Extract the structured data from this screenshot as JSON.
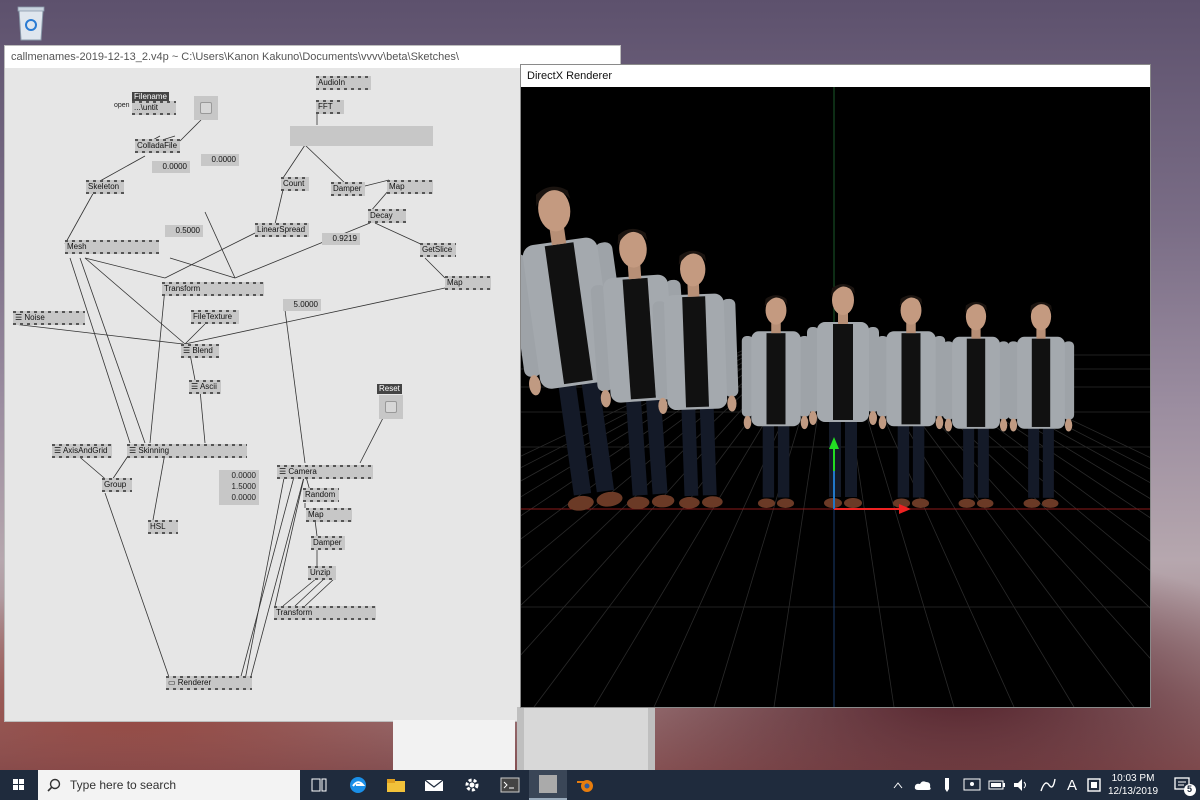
{
  "patch": {
    "title": "callmenames-2019-12-13_2.v4p ~   C:\\Users\\Kanon Kakuno\\Documents\\vvvv\\beta\\Sketches\\",
    "nodes": {
      "filename_label": "Filename",
      "open_label": "open",
      "filename_value": "...\\untit",
      "colladafile": "ColladaFile",
      "audioin": "AudioIn",
      "fft": "FFT",
      "count": "Count",
      "damper1": "Damper",
      "map1": "Map",
      "skeleton": "Skeleton",
      "decay": "Decay",
      "linearspread": "LinearSpread",
      "mesh": "Mesh",
      "getslice": "GetSlice",
      "transform1": "Transform",
      "map2": "Map",
      "noise": "Noise",
      "filetexture": "FileTexture",
      "blend": "Blend",
      "ascii": "Ascii",
      "reset_label": "Reset",
      "axisandgrid": "AxisAndGrid",
      "skinning": "Skinning",
      "camera": "Camera",
      "group": "Group",
      "random": "Random",
      "hsl": "HSL",
      "map3": "Map",
      "damper2": "Damper",
      "unzip": "Unzip",
      "transform2": "Transform",
      "renderer": "Renderer"
    },
    "values": {
      "v1": "0.0000",
      "v2": "0.0000",
      "v3": "0.5000",
      "v4": "0.9219",
      "v5": "5.0000",
      "vec_x": "0.0000",
      "vec_y": "1.5000",
      "vec_z": "0.0000"
    }
  },
  "renderer": {
    "title": "DirectX Renderer",
    "figures": [
      {
        "scale": 1.45,
        "lean": -8
      },
      {
        "scale": 1.25,
        "lean": -4
      },
      {
        "scale": 1.15,
        "lean": -2
      },
      {
        "scale": 0.95,
        "lean": 0
      },
      {
        "scale": 1.0,
        "lean": 0
      },
      {
        "scale": 0.95,
        "lean": 0
      },
      {
        "scale": 0.92,
        "lean": 0
      },
      {
        "scale": 0.92,
        "lean": 0
      }
    ]
  },
  "taskbar": {
    "search_placeholder": "Type here to search",
    "time": "10:03 PM",
    "date": "12/13/2019",
    "notification_count": "5",
    "ime_label": "A"
  }
}
